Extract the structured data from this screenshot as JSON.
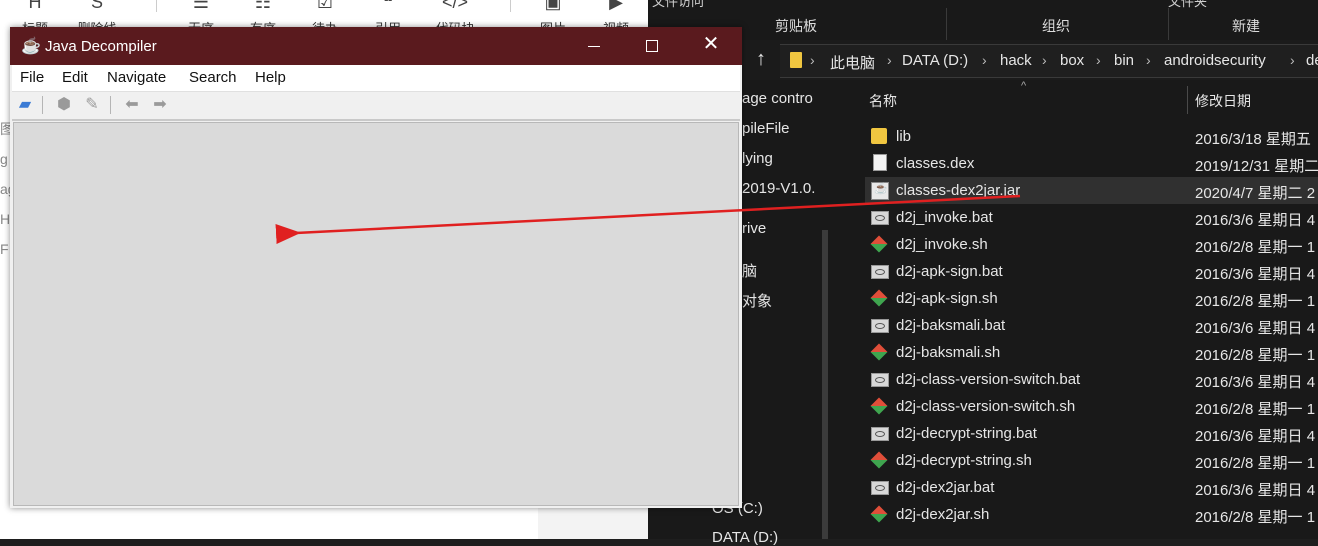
{
  "editor": {
    "toolbar": [
      {
        "label": "标题",
        "icon": "heading-icon"
      },
      {
        "label": "删除线",
        "icon": "strikethrough-icon"
      },
      {
        "label": "无序",
        "icon": "unordered-list-icon"
      },
      {
        "label": "有序",
        "icon": "ordered-list-icon"
      },
      {
        "label": "待办",
        "icon": "todo-icon"
      },
      {
        "label": "引用",
        "icon": "quote-icon"
      },
      {
        "label": "代码块",
        "icon": "code-block-icon"
      },
      {
        "label": "图片",
        "icon": "image-icon"
      },
      {
        "label": "视频",
        "icon": "video-icon"
      }
    ],
    "left_fragments": [
      "图",
      "g",
      "ag",
      "HN",
      "F"
    ]
  },
  "explorer": {
    "ribbon_top_fragment": "文件访问",
    "ribbon_top_fragment2": "文件夹",
    "ribbon_groups": [
      "剪贴板",
      "组织",
      "新建"
    ],
    "address_segments": [
      "此电脑",
      "DATA (D:)",
      "hack",
      "box",
      "bin",
      "androidsecurity",
      "de"
    ],
    "nav_items": [
      "age contro",
      "pileFile",
      "lying",
      "2019-V1.0.",
      "rive",
      "脑",
      "对象",
      "OS (C:)",
      "DATA (D:)"
    ],
    "columns": {
      "name": "名称",
      "date": "修改日期"
    },
    "files": [
      {
        "name": "lib",
        "date": "2016/3/18 星期五",
        "type": "folder"
      },
      {
        "name": "classes.dex",
        "date": "2019/12/31 星期二",
        "type": "file"
      },
      {
        "name": "classes-dex2jar.jar",
        "date": "2020/4/7 星期二 2",
        "type": "jar",
        "selected": true
      },
      {
        "name": "d2j_invoke.bat",
        "date": "2016/3/6 星期日 4",
        "type": "bat"
      },
      {
        "name": "d2j_invoke.sh",
        "date": "2016/2/8 星期一 1",
        "type": "sh"
      },
      {
        "name": "d2j-apk-sign.bat",
        "date": "2016/3/6 星期日 4",
        "type": "bat"
      },
      {
        "name": "d2j-apk-sign.sh",
        "date": "2016/2/8 星期一 1",
        "type": "sh"
      },
      {
        "name": "d2j-baksmali.bat",
        "date": "2016/3/6 星期日 4",
        "type": "bat"
      },
      {
        "name": "d2j-baksmali.sh",
        "date": "2016/2/8 星期一 1",
        "type": "sh"
      },
      {
        "name": "d2j-class-version-switch.bat",
        "date": "2016/3/6 星期日 4",
        "type": "bat"
      },
      {
        "name": "d2j-class-version-switch.sh",
        "date": "2016/2/8 星期一 1",
        "type": "sh"
      },
      {
        "name": "d2j-decrypt-string.bat",
        "date": "2016/3/6 星期日 4",
        "type": "bat"
      },
      {
        "name": "d2j-decrypt-string.sh",
        "date": "2016/2/8 星期一 1",
        "type": "sh"
      },
      {
        "name": "d2j-dex2jar.bat",
        "date": "2016/3/6 星期日 4",
        "type": "bat"
      },
      {
        "name": "d2j-dex2jar.sh",
        "date": "2016/2/8 星期一 1",
        "type": "sh"
      }
    ]
  },
  "jd": {
    "title": "Java Decompiler",
    "menu": [
      "File",
      "Edit",
      "Navigate",
      "Search",
      "Help"
    ],
    "toolbar_icons": [
      "open-folder-icon",
      "open-type-icon",
      "search-brush-icon",
      "back-arrow-icon",
      "forward-arrow-icon"
    ],
    "window_controls": {
      "minimize": "minimize-icon",
      "maximize": "maximize-icon",
      "close": "close-icon"
    }
  },
  "annotation": {
    "arrow_color": "#e02020"
  },
  "colors": {
    "jd_titlebar": "#5a1a1e",
    "explorer_bg": "#191919",
    "jd_content": "#dadada"
  }
}
